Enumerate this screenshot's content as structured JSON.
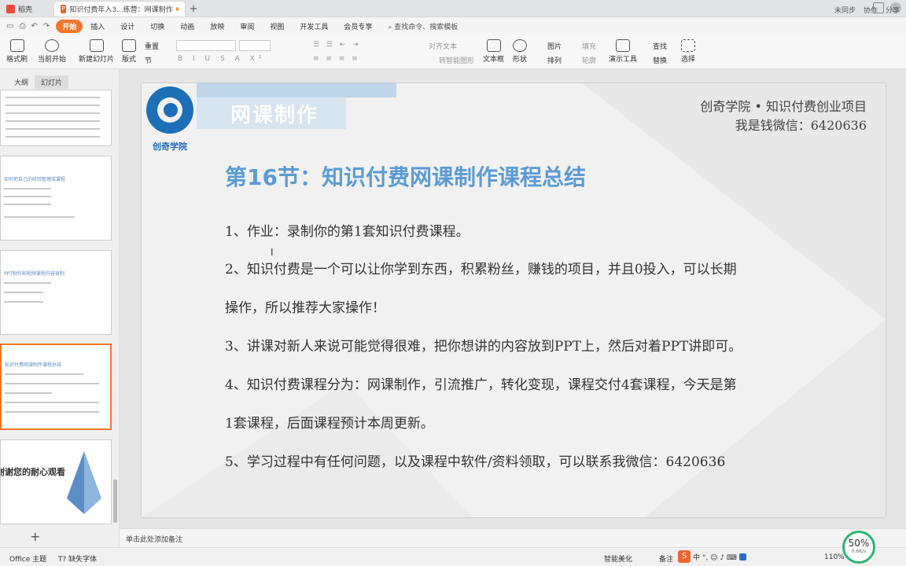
{
  "tabs": {
    "home": "稻壳",
    "doc": "知识付费年入3...练营：网课制作"
  },
  "menu": {
    "start": "开始",
    "items": [
      "插入",
      "设计",
      "切换",
      "动画",
      "放映",
      "审阅",
      "视图",
      "开发工具",
      "会员专享"
    ],
    "search": "查找命令、搜索模板",
    "sync": "未同步",
    "collab": "协作",
    "share": "分享"
  },
  "ribbon": {
    "format_painter": "格式刷",
    "from_start": "当前开始",
    "new_slide": "新建幻灯片",
    "layout": "版式",
    "section": "节",
    "reset": "重置",
    "align_text": "对齐文本",
    "smart_shape": "转智能图形",
    "textbox": "文本框",
    "shape": "形状",
    "picture": "图片",
    "arrange": "排列",
    "fill": "填充",
    "outline": "轮廓",
    "present_tool": "演示工具",
    "find": "查找",
    "replace": "替换",
    "select": "选择"
  },
  "panel": {
    "tab_outline": "大纲",
    "tab_slides": "幻灯片",
    "thumb2_title": "如何把自己的经验整理成课程",
    "thumb3_title": "PPT制作和视频课程内容录制",
    "thumb4_title": "知识付费网课制作课程总结",
    "thumb5_title": "谢谢您的耐心观看",
    "add": "+"
  },
  "slide": {
    "logo": "创奇学院",
    "course": "网课制作",
    "header1": "创奇学院 • 知识付费创业项目",
    "header2": "我是钱微信：6420636",
    "heading": "第16节：知识付费网课制作课程总结",
    "bullets": [
      "1、作业：录制你的第1套知识付费课程。",
      "2、知识付费是一个可以让你学到东西，积累粉丝，赚钱的项目，并且0投入，可以长期",
      "操作，所以推荐大家操作！",
      "3、讲课对新人来说可能觉得很难，把你想讲的内容放到PPT上，然后对着PPT讲即可。",
      "4、知识付费课程分为：网课制作，引流推广，转化变现，课程交付4套课程，今天是第",
      "1套课程，后面课程预计本周更新。",
      "5、学习过程中有任何问题，以及课程中软件/资料领取，可以联系我微信：6420636"
    ]
  },
  "notes": "单击此处添加备注",
  "status": {
    "theme": "Office 主题",
    "missing_font": "缺失字体",
    "smart_beautify": "智能美化",
    "notes_btn": "备注",
    "zoom": "110%",
    "progress_pct": "50%",
    "progress_speed": "0.6K/s"
  }
}
